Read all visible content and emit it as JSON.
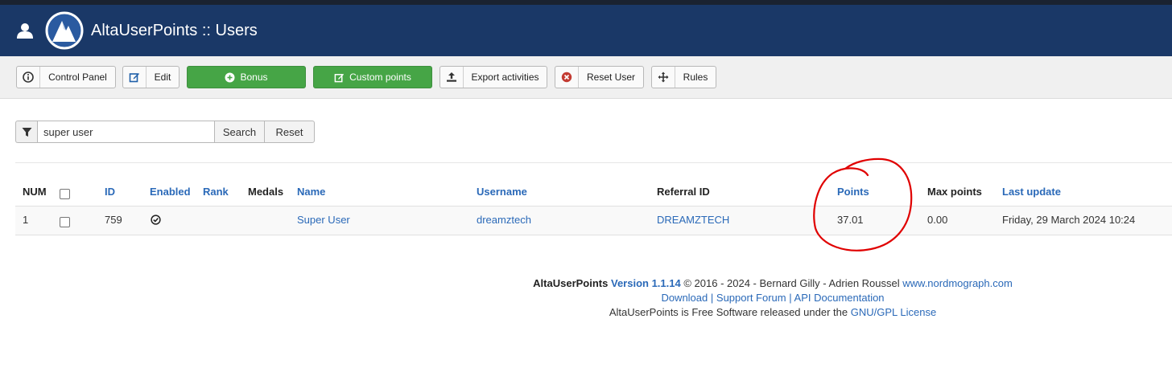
{
  "header": {
    "title": "AltaUserPoints :: Users"
  },
  "toolbar": {
    "buttons": [
      {
        "label": "Control Panel",
        "icon": "info-circle-icon"
      },
      {
        "label": "Edit",
        "icon": "edit-icon"
      },
      {
        "label": "Bonus",
        "icon": "plus-circle-icon",
        "color": "#46a546"
      },
      {
        "label": "Custom points",
        "icon": "edit-icon",
        "color": "#46a546"
      },
      {
        "label": "Export activities",
        "icon": "upload-icon"
      },
      {
        "label": "Reset User",
        "icon": "cancel-circle-icon",
        "icon_color": "#c33b32"
      },
      {
        "label": "Rules",
        "icon": "move-icon"
      }
    ]
  },
  "search": {
    "value": "super user",
    "search_label": "Search",
    "reset_label": "Reset"
  },
  "table": {
    "columns": [
      "NUM",
      "ID",
      "Enabled",
      "Rank",
      "Medals",
      "Name",
      "Username",
      "Referral ID",
      "Points",
      "Max points",
      "Last update"
    ],
    "rows": [
      {
        "num": "1",
        "id": "759",
        "enabled": true,
        "rank": "",
        "medals": "",
        "name": "Super User",
        "username": "dreamztech",
        "referral_id": "DREAMZTECH",
        "points": "37.01",
        "max_points": "0.00",
        "last_update": "Friday, 29 March 2024 10:24"
      }
    ]
  },
  "footer": {
    "product": "AltaUserPoints",
    "version": "Version 1.1.14",
    "copyright": "© 2016 - 2024 - Bernard Gilly - Adrien Roussel",
    "website": "www.nordmograph.com",
    "download": "Download",
    "sep": "|",
    "support": "Support Forum",
    "api": "API Documentation",
    "license_text": "AltaUserPoints is Free Software released under the",
    "license_link": "GNU/GPL License"
  },
  "colors": {
    "header_bg": "#1a3867",
    "link": "#2a69b8",
    "green": "#46a546",
    "annotation": "#e00000"
  }
}
